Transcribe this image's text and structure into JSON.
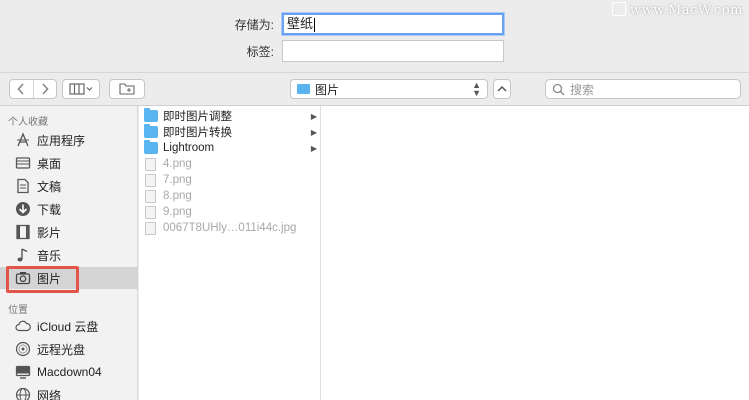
{
  "watermark": "www.MacW.com",
  "save": {
    "name_label": "存储为:",
    "name_value": "壁纸",
    "tags_label": "标签:",
    "tags_value": ""
  },
  "toolbar": {
    "back_icon": "chevron-left-icon",
    "forward_icon": "chevron-right-icon",
    "view_icon": "column-view-icon",
    "new_folder_icon": "new-folder-icon",
    "location_label": "图片",
    "search_placeholder": "搜索"
  },
  "sidebar": {
    "favorites_header": "个人收藏",
    "favorites": [
      {
        "label": "应用程序",
        "icon": "applications-icon"
      },
      {
        "label": "桌面",
        "icon": "desktop-icon"
      },
      {
        "label": "文稿",
        "icon": "documents-icon"
      },
      {
        "label": "下载",
        "icon": "downloads-icon"
      },
      {
        "label": "影片",
        "icon": "movies-icon"
      },
      {
        "label": "音乐",
        "icon": "music-icon"
      },
      {
        "label": "图片",
        "icon": "pictures-icon",
        "selected": true
      }
    ],
    "locations_header": "位置",
    "locations": [
      {
        "label": "iCloud 云盘",
        "icon": "cloud-icon"
      },
      {
        "label": "远程光盘",
        "icon": "disc-icon"
      },
      {
        "label": "Macdown04",
        "icon": "computer-icon"
      },
      {
        "label": "网络",
        "icon": "network-icon"
      }
    ]
  },
  "files": [
    {
      "name": "即时图片调整",
      "type": "folder",
      "enabled": true
    },
    {
      "name": "即时图片转换",
      "type": "folder",
      "enabled": true
    },
    {
      "name": "Lightroom",
      "type": "folder",
      "enabled": true
    },
    {
      "name": "4.png",
      "type": "file",
      "enabled": false
    },
    {
      "name": "7.png",
      "type": "file",
      "enabled": false
    },
    {
      "name": "8.png",
      "type": "file",
      "enabled": false
    },
    {
      "name": "9.png",
      "type": "file",
      "enabled": false
    },
    {
      "name": "0067T8UHly…011i44c.jpg",
      "type": "file",
      "enabled": false
    }
  ],
  "colors": {
    "accent": "#5ab4f0",
    "highlight": "#e2564a",
    "focus_ring": "#6aa2f0"
  }
}
